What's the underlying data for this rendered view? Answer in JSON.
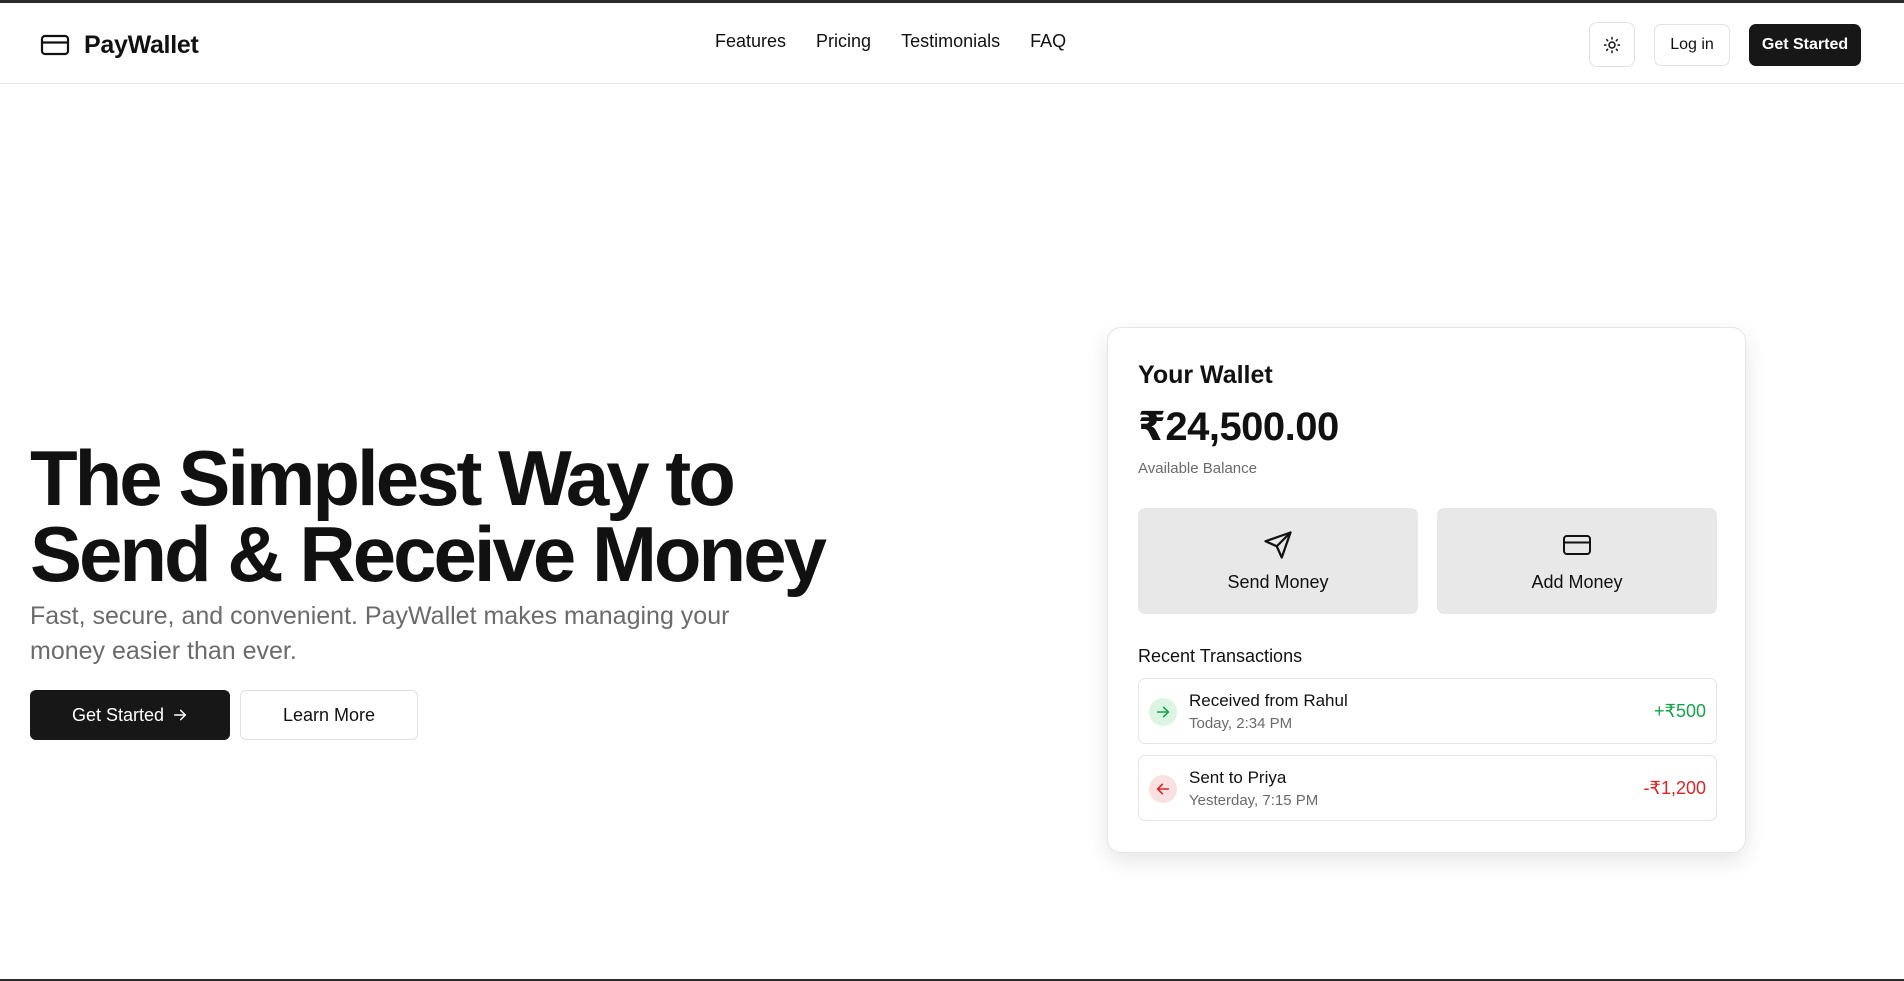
{
  "header": {
    "brand": "PayWallet",
    "brand_icon": "credit-card-icon",
    "nav": [
      "Features",
      "Pricing",
      "Testimonials",
      "FAQ"
    ],
    "theme_icon": "sun-icon",
    "login_label": "Log in",
    "get_started_label": "Get Started"
  },
  "hero": {
    "title": "The Simplest Way to Send & Receive Money",
    "subtitle": "Fast, secure, and convenient. PayWallet makes managing your money easier than ever.",
    "primary_cta": "Get Started",
    "primary_cta_icon": "arrow-right-icon",
    "secondary_cta": "Learn More"
  },
  "wallet": {
    "title": "Your Wallet",
    "balance": "₹24,500.00",
    "balance_caption": "Available Balance",
    "actions": [
      {
        "label": "Send Money",
        "icon": "send-icon"
      },
      {
        "label": "Add Money",
        "icon": "credit-card-icon"
      }
    ],
    "recent_label": "Recent Transactions",
    "transactions": [
      {
        "name": "Received from Rahul",
        "time": "Today, 2:34 PM",
        "amount": "+₹500",
        "direction": "in",
        "icon": "arrow-right-icon"
      },
      {
        "name": "Sent to Priya",
        "time": "Yesterday, 7:15 PM",
        "amount": "-₹1,200",
        "direction": "out",
        "icon": "arrow-left-icon"
      }
    ]
  },
  "colors": {
    "primary": "#171717",
    "positive": "#16a34a",
    "negative": "#dc2626",
    "muted_text": "#6b6b6b",
    "tile_bg": "#e8e8e8"
  }
}
